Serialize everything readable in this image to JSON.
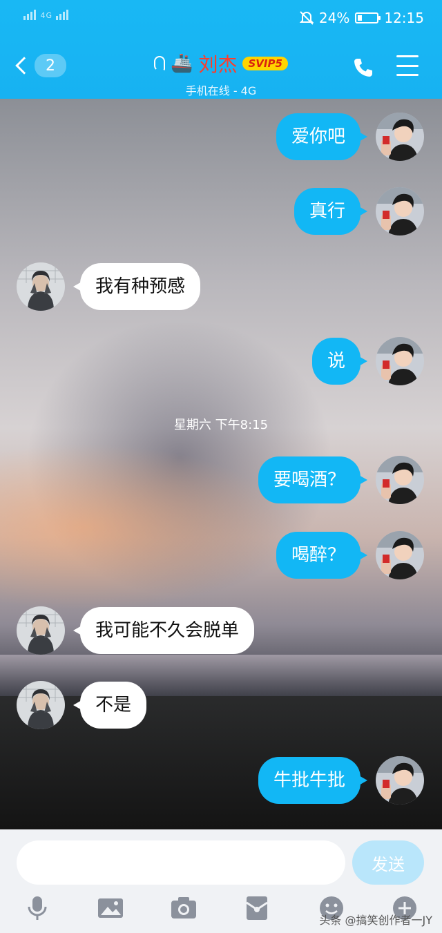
{
  "statusbar": {
    "network": "4G",
    "battery": "24%",
    "battery_level": 0.24,
    "time": "12:15"
  },
  "header": {
    "back_count": "2",
    "contact_name": "刘杰",
    "vip_badge": "SVIP5",
    "subtitle": "手机在线 - 4G",
    "icons": [
      "back-chevron-icon",
      "ear-icon",
      "ship-icon",
      "phone-icon",
      "menu-icon"
    ]
  },
  "messages": [
    {
      "side": "out",
      "text": "爱你吧"
    },
    {
      "side": "out",
      "text": "真行"
    },
    {
      "side": "in",
      "text": "我有种预感"
    },
    {
      "side": "out",
      "text": "说"
    },
    {
      "side": "out",
      "text": "要喝酒？"
    },
    {
      "side": "out",
      "text": "喝醉？"
    },
    {
      "side": "in",
      "text": "我可能不久会脱单"
    },
    {
      "side": "in",
      "text": "不是"
    },
    {
      "side": "out",
      "text": "牛批牛批"
    }
  ],
  "timestamp": "星期六 下午8:15",
  "input": {
    "value": "",
    "send_label": "发送"
  },
  "toolbar": [
    "microphone-icon",
    "image-icon",
    "camera-icon",
    "red-packet-icon",
    "emoji-icon",
    "plus-icon"
  ],
  "watermark": "头条 @搞笑创作者一JY",
  "colors": {
    "header": "#17b2f2",
    "outgoing_bubble": "#12b7f5",
    "incoming_bubble": "#ffffff",
    "name": "#ff3c2a",
    "svip_badge": "#ffd400"
  }
}
